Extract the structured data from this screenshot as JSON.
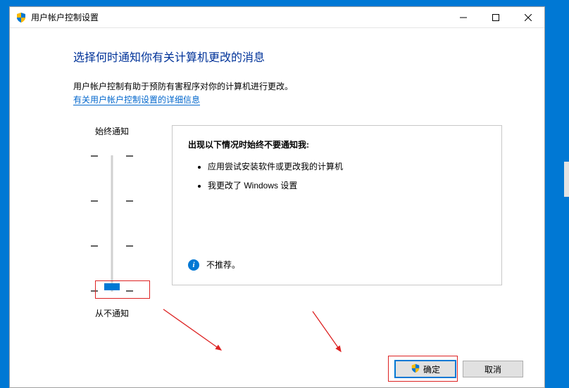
{
  "window": {
    "title": "用户帐户控制设置"
  },
  "content": {
    "heading": "选择何时通知你有关计算机更改的消息",
    "description": "用户帐户控制有助于预防有害程序对你的计算机进行更改。",
    "link": "有关用户帐户控制设置的详细信息"
  },
  "slider": {
    "topLabel": "始终通知",
    "bottomLabel": "从不通知"
  },
  "infoBox": {
    "title": "出现以下情况时始终不要通知我:",
    "items": [
      "应用尝试安装软件或更改我的计算机",
      "我更改了 Windows 设置"
    ],
    "note": "不推荐。"
  },
  "buttons": {
    "ok": "确定",
    "cancel": "取消"
  }
}
